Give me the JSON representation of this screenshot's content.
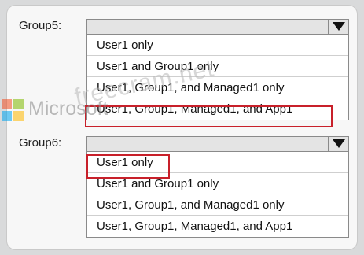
{
  "group5": {
    "label": "Group5:",
    "selected_value": "",
    "options": [
      "User1 only",
      "User1 and Group1 only",
      "User1, Group1, and Managed1 only",
      "User1, Group1, Managed1, and App1"
    ],
    "highlighted_index": 3
  },
  "group6": {
    "label": "Group6:",
    "selected_value": "",
    "options": [
      "User1 only",
      "User1 and Group1 only",
      "User1, Group1, and Managed1 only",
      "User1, Group1, Managed1, and App1"
    ],
    "highlighted_index": 0
  },
  "watermark": {
    "brand": "Microsoft",
    "site": "freecram.net"
  },
  "colors": {
    "highlight_border": "#c8202a",
    "logo_red": "#f25022",
    "logo_green": "#7fba00",
    "logo_blue": "#00a4ef",
    "logo_yellow": "#ffb900"
  }
}
